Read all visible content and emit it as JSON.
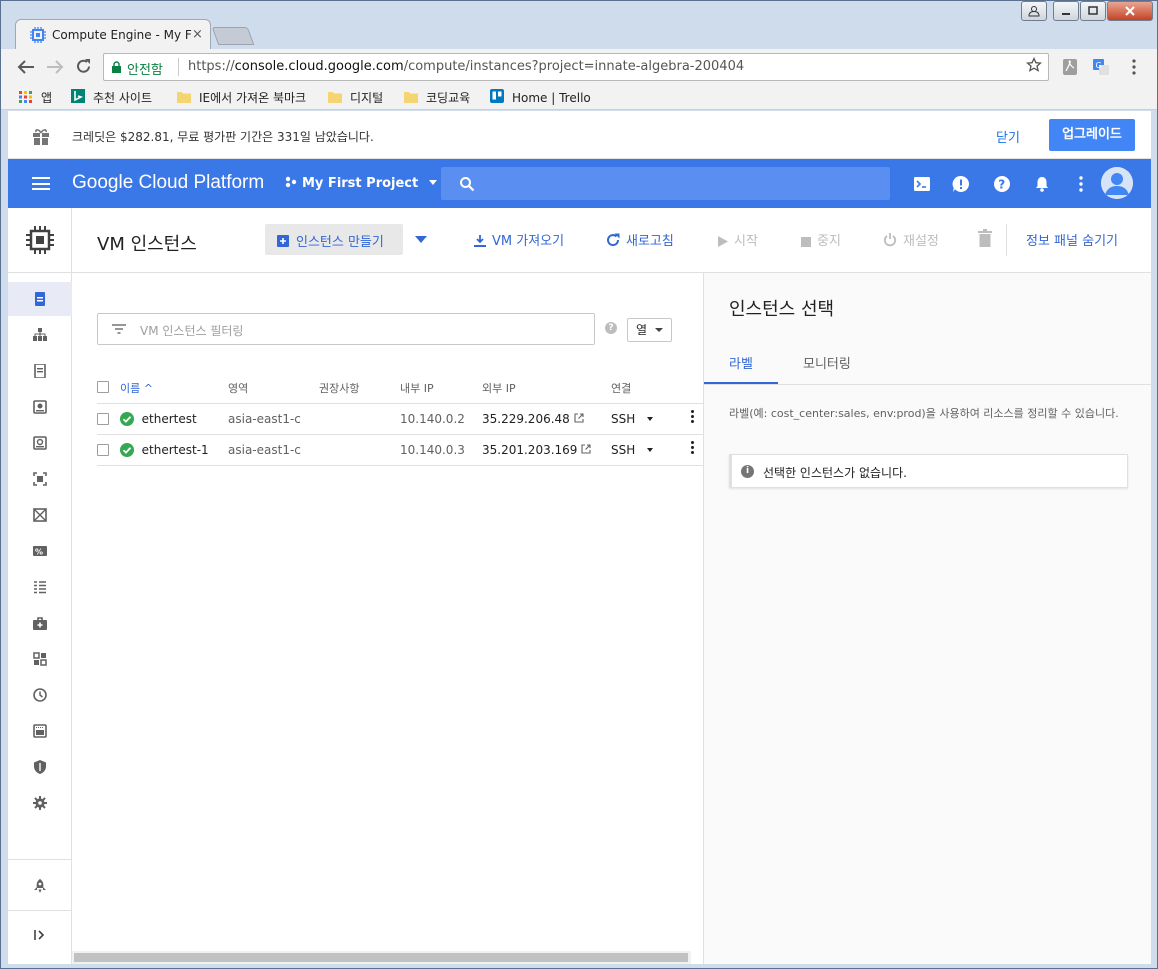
{
  "browser": {
    "tab_title": "Compute Engine - My F",
    "tab_close": "×",
    "secure_label": "안전함",
    "url_scheme": "https://",
    "url_host": "console.cloud.google.com",
    "url_path": "/compute/instances?project=innate-algebra-200404"
  },
  "bookmarks": [
    {
      "label": "앱"
    },
    {
      "label": "추천 사이트"
    },
    {
      "label": "IE에서 가져온 북마크"
    },
    {
      "label": "디지털"
    },
    {
      "label": "코딩교육"
    },
    {
      "label": "Home | Trello"
    }
  ],
  "credit_bar": {
    "message": "크레딧은 $282.81, 무료 평가판 기간은 331일 남았습니다.",
    "close_label": "닫기",
    "upgrade_label": "업그레이드"
  },
  "gcp": {
    "brand": "Google Cloud Platform",
    "project": "My First Project"
  },
  "header": {
    "title": "VM 인스턴스",
    "create_label": "인스턴스 만들기",
    "import_label": "VM 가져오기",
    "refresh_label": "새로고침",
    "start_label": "시작",
    "stop_label": "중지",
    "reset_label": "재설정",
    "hide_panel_label": "정보 패널 숨기기"
  },
  "filter": {
    "placeholder": "VM 인스턴스 필터링",
    "columns_label": "열",
    "help": "?"
  },
  "table": {
    "headers": {
      "name": "이름 ^",
      "zone": "영역",
      "recommendation": "권장사항",
      "internal_ip": "내부 IP",
      "external_ip": "외부 IP",
      "connect": "연결"
    },
    "rows": [
      {
        "name": "ethertest",
        "zone": "asia-east1-c",
        "recommendation": "",
        "internal_ip": "10.140.0.2",
        "external_ip": "35.229.206.48",
        "connect": "SSH"
      },
      {
        "name": "ethertest-1",
        "zone": "asia-east1-c",
        "recommendation": "",
        "internal_ip": "10.140.0.3",
        "external_ip": "35.201.203.169",
        "connect": "SSH"
      }
    ]
  },
  "panel": {
    "title": "인스턴스 선택",
    "tab_labels": "라벨",
    "tab_monitoring": "모니터링",
    "description": "라벨(예: cost_center:sales, env:prod)을 사용하여 리소스를 정리할 수 있습니다.",
    "info_icon": "i",
    "info_message": "선택한 인스턴스가 없습니다."
  },
  "colors": {
    "brand_blue": "#3b78e7",
    "link_blue": "#3367d6",
    "status_green": "#34a853"
  }
}
